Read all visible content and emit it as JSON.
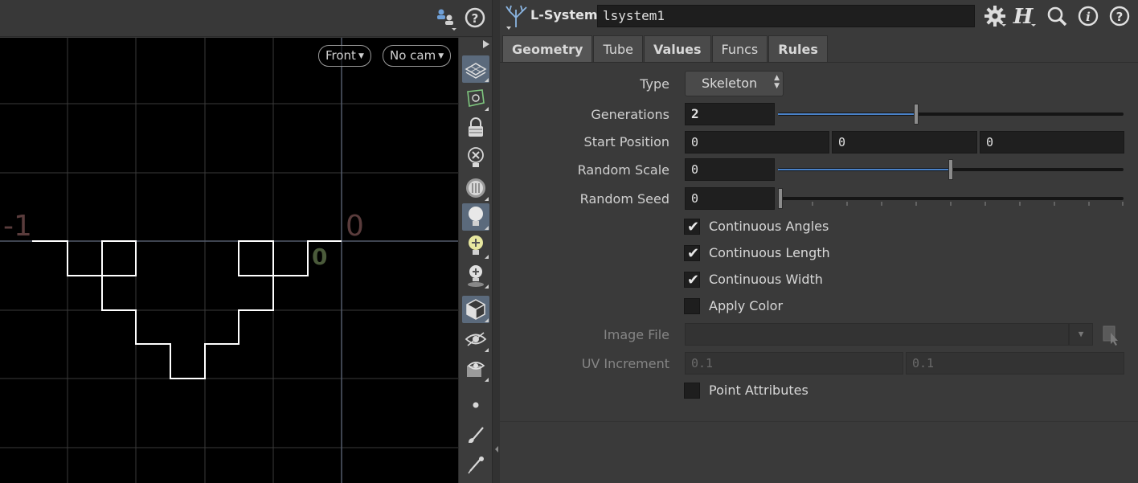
{
  "viewer": {
    "view_menu": "Front",
    "camera_menu": "No cam",
    "axis_label_neg": "-1",
    "axis_label_zero": "0",
    "origin_marker": "0"
  },
  "node": {
    "type": "L-System",
    "name": "lsystem1"
  },
  "tabs": [
    {
      "label": "Geometry"
    },
    {
      "label": "Tube"
    },
    {
      "label": "Values"
    },
    {
      "label": "Funcs"
    },
    {
      "label": "Rules"
    }
  ],
  "params": {
    "type": {
      "label": "Type",
      "value": "Skeleton"
    },
    "generations": {
      "label": "Generations",
      "value": "2",
      "slider_fraction": 0.4
    },
    "start_position": {
      "label": "Start Position",
      "x": "0",
      "y": "0",
      "z": "0"
    },
    "random_scale": {
      "label": "Random Scale",
      "value": "0",
      "slider_fraction": 0.5
    },
    "random_seed": {
      "label": "Random Seed",
      "value": "0",
      "slider_fraction": 0.0
    },
    "continuous_angles": {
      "label": "Continuous Angles",
      "checked": true
    },
    "continuous_length": {
      "label": "Continuous Length",
      "checked": true
    },
    "continuous_width": {
      "label": "Continuous Width",
      "checked": true
    },
    "apply_color": {
      "label": "Apply Color",
      "checked": false
    },
    "image_file": {
      "label": "Image File",
      "value": ""
    },
    "uv_increment": {
      "label": "UV Increment",
      "u": "0.1",
      "v": "0.1"
    },
    "point_attributes": {
      "label": "Point Attributes",
      "checked": false
    }
  },
  "colors": {
    "accent": "#4a82c8",
    "active_tool": "#5b6a7c",
    "curve": "#ffffff",
    "grid": "#3a3a3a"
  }
}
